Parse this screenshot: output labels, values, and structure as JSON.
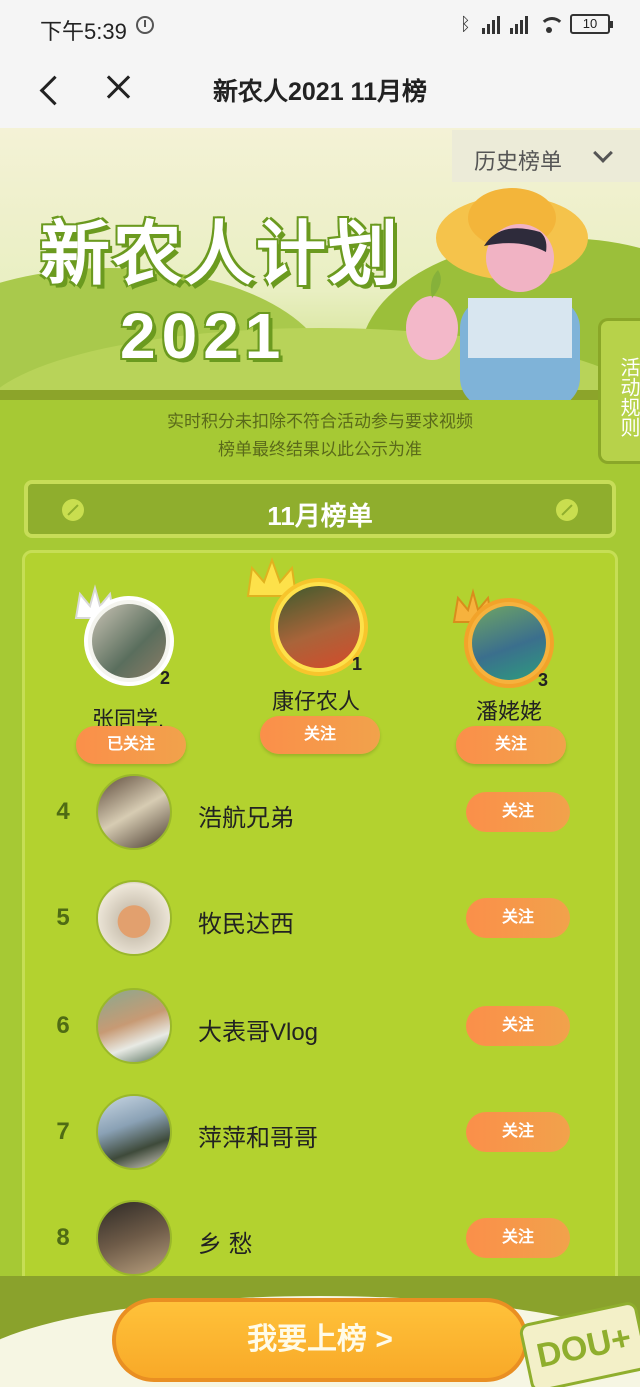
{
  "status_bar": {
    "time": "下午5:39",
    "battery": "10"
  },
  "nav": {
    "title": "新农人2021 11月榜"
  },
  "banner": {
    "history_label": "历史榜单",
    "logo_line1": "新农人计划",
    "logo_line2": "2021",
    "side_tab": "活动规则"
  },
  "notice": {
    "line1": "实时积分未扣除不符合活动参与要求视频",
    "line2": "榜单最终结果以此公示为准"
  },
  "board": {
    "title": "11月榜单"
  },
  "podium": [
    {
      "rank": "2",
      "name": "张同学.",
      "button": "已关注"
    },
    {
      "rank": "1",
      "name": "康仔农人",
      "button": "关注"
    },
    {
      "rank": "3",
      "name": "潘姥姥",
      "button": "关注"
    }
  ],
  "ranking": [
    {
      "rank": "4",
      "name": "浩航兄弟",
      "button": "关注"
    },
    {
      "rank": "5",
      "name": "牧民达西",
      "button": "关注"
    },
    {
      "rank": "6",
      "name": "大表哥Vlog",
      "button": "关注"
    },
    {
      "rank": "7",
      "name": "萍萍和哥哥",
      "button": "关注"
    },
    {
      "rank": "8",
      "name": "乡 愁",
      "button": "关注"
    }
  ],
  "cta": {
    "label": "我要上榜 >"
  },
  "badge": {
    "label": "DOU+"
  },
  "colors": {
    "accent": "#a6c934",
    "button": "#fb8f4a",
    "cta": "#ffc23a"
  }
}
